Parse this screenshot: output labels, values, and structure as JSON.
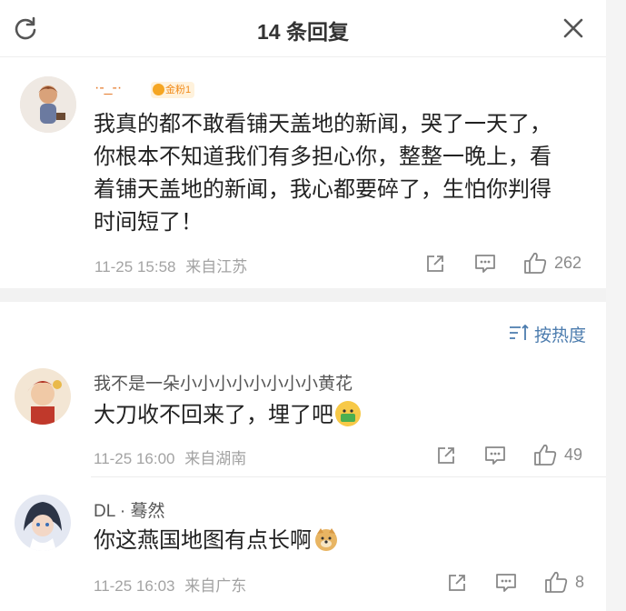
{
  "header": {
    "title": "14 条回复"
  },
  "main_comment": {
    "username": "·-_-·",
    "badge": "金粉1",
    "text_lines": [
      "我真的都不敢看铺天盖地的新闻，哭了一天了，",
      "你根本不知道我们有多担心你，整整一晚上，看",
      "着铺天盖地的新闻，我心都要碎了，生怕你判得",
      "时间短了！"
    ],
    "timestamp": "11-25 15:58",
    "location": "来自江苏",
    "likes": "262"
  },
  "sort": {
    "label": "按热度"
  },
  "replies": [
    {
      "username": "我不是一朵小小小小小小小小黄花",
      "text": "大刀收不回来了，埋了吧",
      "emoji": "money-face-emoji",
      "timestamp": "11-25 16:00",
      "location": "来自湖南",
      "likes": "49"
    },
    {
      "username": "DL · 蓦然",
      "text": "你这燕国地图有点长啊",
      "emoji": "doge-emoji",
      "timestamp": "11-25 16:03",
      "location": "来自广东",
      "likes": "8"
    }
  ],
  "colors": {
    "link_blue": "#4c7cae",
    "meta_gray": "#a3a3a3",
    "badge_orange": "#f28b1a"
  }
}
